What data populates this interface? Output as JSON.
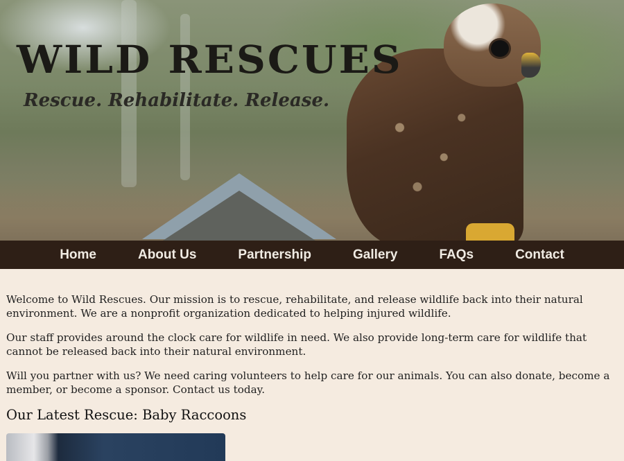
{
  "site": {
    "logo_text": "WILD RESCUES",
    "tagline": "Rescue. Rehabilitate. Release."
  },
  "nav": {
    "items": [
      {
        "label": "Home"
      },
      {
        "label": "About Us"
      },
      {
        "label": "Partnership"
      },
      {
        "label": "Gallery"
      },
      {
        "label": "FAQs"
      },
      {
        "label": "Contact"
      }
    ]
  },
  "main": {
    "paragraphs": [
      "Welcome to Wild Rescues. Our mission is to rescue, rehabilitate, and release wildlife back into their natural environment. We are a nonprofit organization dedicated to helping injured wildlife.",
      "Our staff provides around the clock care for wildlife in need. We also provide long-term care for wildlife that cannot be released back into their natural environment.",
      "Will you partner with us? We need caring volunteers to help care for our animals. You can also donate, become a member, or become a sponsor. Contact us today."
    ],
    "latest_heading": "Our Latest Rescue: Baby Raccoons"
  },
  "colors": {
    "nav_bg": "#2e1f16",
    "page_bg": "#f5ebe0",
    "nav_text": "#f1ece4"
  }
}
